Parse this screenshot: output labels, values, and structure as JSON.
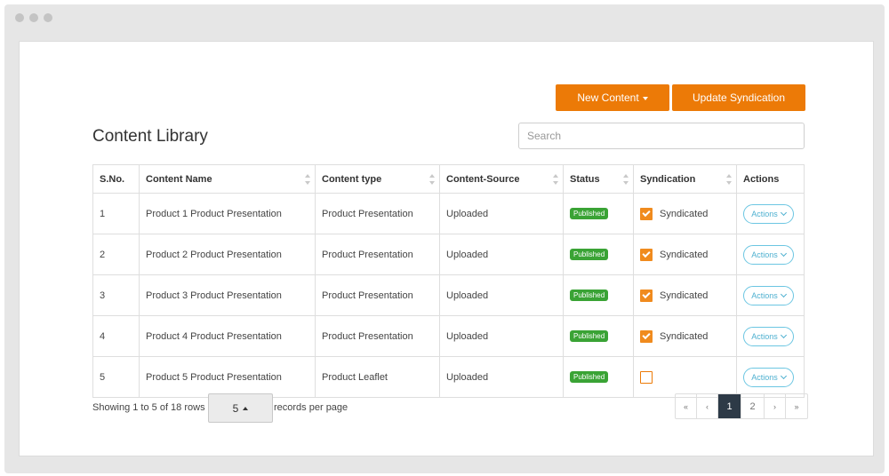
{
  "toolbar": {
    "new_content_label": "New Content",
    "update_syndication_label": "Update Syndication"
  },
  "page": {
    "title": "Content Library"
  },
  "search": {
    "placeholder": "Search"
  },
  "colors": {
    "accent": "#ec7a07",
    "published": "#3aa335",
    "actions": "#4eb0d0",
    "pager_active": "#2d3a47"
  },
  "table": {
    "headers": {
      "sno": "S.No.",
      "name": "Content Name",
      "type": "Content type",
      "source": "Content-Source",
      "status": "Status",
      "syndication": "Syndication",
      "actions": "Actions"
    },
    "rows": [
      {
        "sno": "1",
        "name": "Product 1 Product Presentation",
        "type": "Product Presentation",
        "source": "Uploaded",
        "status": "Published",
        "syndicated": true,
        "syndication_label": "Syndicated",
        "actions_label": "Actions"
      },
      {
        "sno": "2",
        "name": "Product 2 Product Presentation",
        "type": "Product Presentation",
        "source": "Uploaded",
        "status": "Published",
        "syndicated": true,
        "syndication_label": "Syndicated",
        "actions_label": "Actions"
      },
      {
        "sno": "3",
        "name": "Product 3 Product Presentation",
        "type": "Product Presentation",
        "source": "Uploaded",
        "status": "Published",
        "syndicated": true,
        "syndication_label": "Syndicated",
        "actions_label": "Actions"
      },
      {
        "sno": "4",
        "name": "Product 4 Product Presentation",
        "type": "Product Presentation",
        "source": "Uploaded",
        "status": "Published",
        "syndicated": true,
        "syndication_label": "Syndicated",
        "actions_label": "Actions"
      },
      {
        "sno": "5",
        "name": "Product 5 Product Presentation",
        "type": "Product Leaflet",
        "source": "Uploaded",
        "status": "Published",
        "syndicated": false,
        "syndication_label": "",
        "actions_label": "Actions"
      }
    ]
  },
  "footer": {
    "showing_text": "Showing 1 to 5 of 18 rows",
    "per_page_value": "5",
    "records_per_page_label": "records per page"
  },
  "pagination": {
    "first": "«",
    "prev": "‹",
    "pages": [
      "1",
      "2"
    ],
    "current": "1",
    "next": "›",
    "last": "»"
  }
}
